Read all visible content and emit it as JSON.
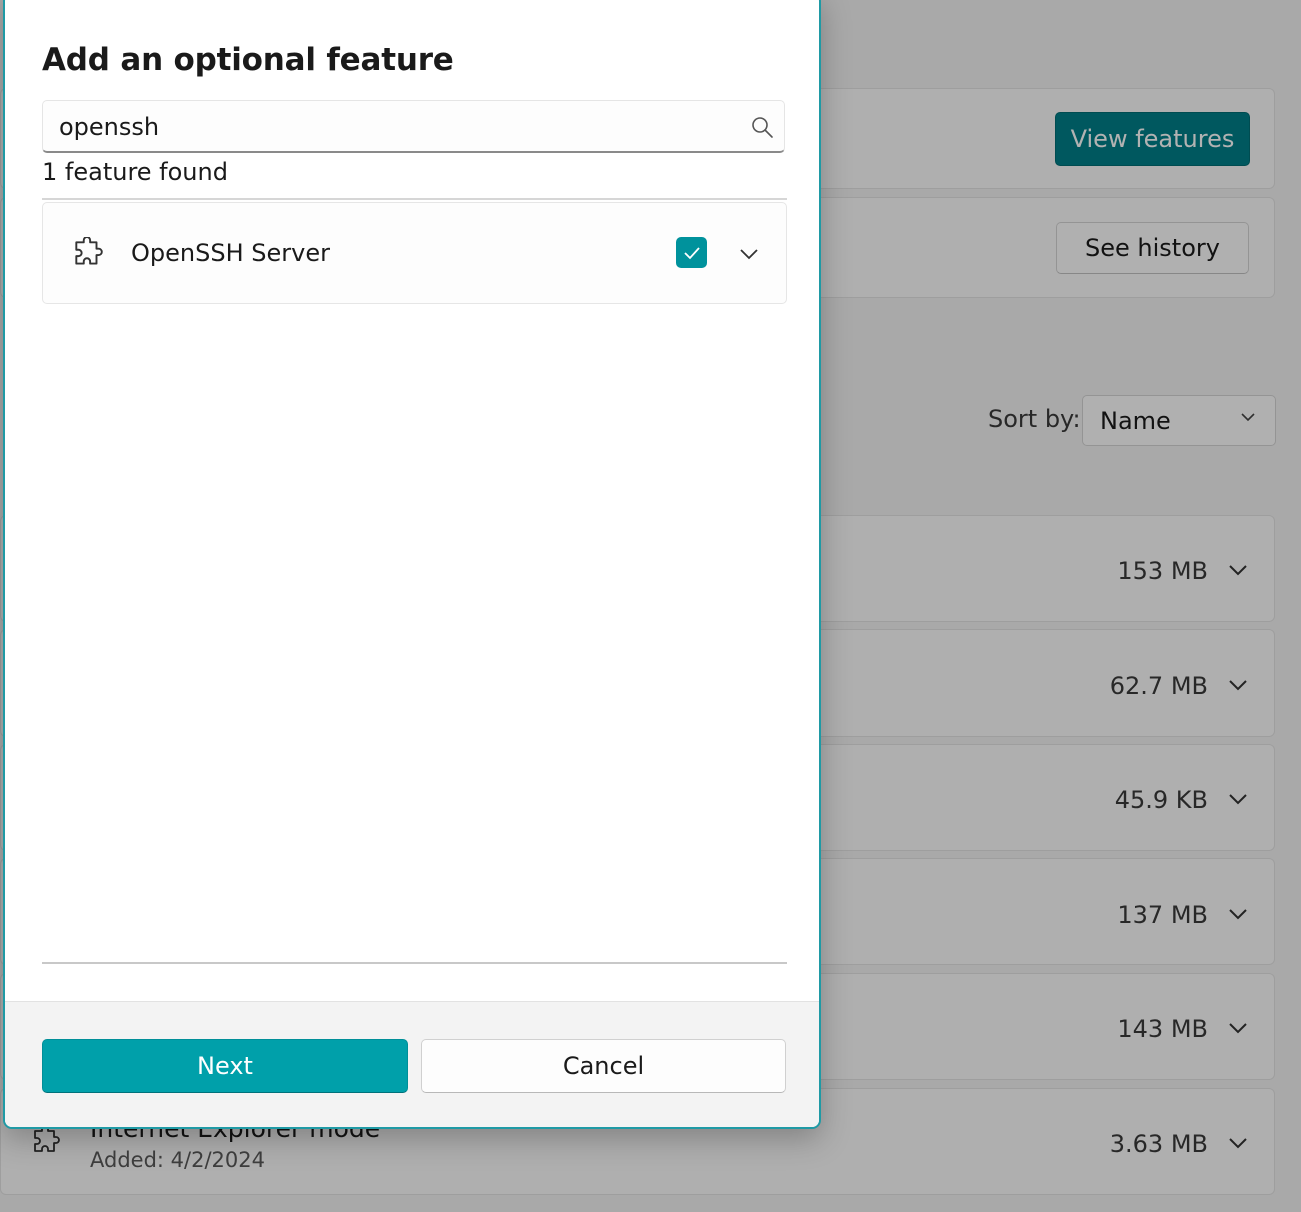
{
  "background": {
    "view_features_label": "View features",
    "see_history_label": "See history",
    "sort_by_label": "Sort by:",
    "sort_value": "Name",
    "feature_sizes": [
      "153 MB",
      "62.7 MB",
      "45.9 KB",
      "137 MB",
      "143 MB",
      "3.63 MB"
    ],
    "ie_feature": {
      "title": "Internet Explorer mode",
      "added": "Added: 4/2/2024"
    }
  },
  "dialog": {
    "title": "Add an optional feature",
    "search": {
      "value": "openssh",
      "icon": "search-icon"
    },
    "results_count": "1 feature found",
    "results": [
      {
        "label": "OpenSSH Server",
        "checked": true,
        "icon": "puzzle-icon"
      }
    ],
    "next_label": "Next",
    "cancel_label": "Cancel"
  },
  "colors": {
    "accent": "#00a0aa",
    "accent_dark": "#007f88",
    "dialog_border": "#1f9aa5"
  }
}
